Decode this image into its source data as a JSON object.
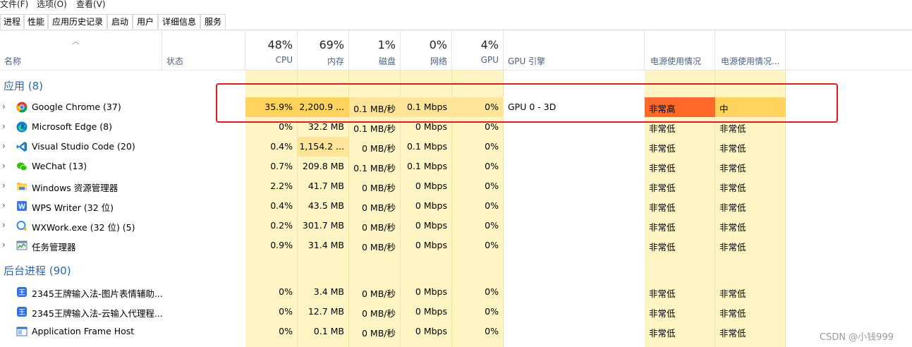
{
  "menu": [
    "文件(F)",
    "选项(O)",
    "查看(V)"
  ],
  "tabs": [
    "进程",
    "性能",
    "应用历史记录",
    "启动",
    "用户",
    "详细信息",
    "服务"
  ],
  "columns": {
    "name": "名称",
    "status": "状态",
    "cpu": {
      "pct": "48%",
      "label": "CPU"
    },
    "memory": {
      "pct": "69%",
      "label": "内存"
    },
    "disk": {
      "pct": "1%",
      "label": "磁盘"
    },
    "network": {
      "pct": "0%",
      "label": "网络"
    },
    "gpu": {
      "pct": "4%",
      "label": "GPU"
    },
    "gpu_engine": "GPU 引擎",
    "power": "电源使用情况",
    "power_trend": "电源使用情况..."
  },
  "sections": {
    "apps": "应用 (8)",
    "background": "后台进程 (90)"
  },
  "apps": [
    {
      "name": "Google Chrome (37)",
      "icon": "chrome-icon",
      "cpu": "35.9%",
      "mem": "2,200.9 ...",
      "disk": "0.1 MB/秒",
      "net": "0.1 Mbps",
      "gpu": "0%",
      "engine": "GPU 0 - 3D",
      "power": "非常高",
      "trend": "中"
    },
    {
      "name": "Microsoft Edge (8)",
      "icon": "edge-icon",
      "cpu": "0%",
      "mem": "32.2 MB",
      "disk": "0.1 MB/秒",
      "net": "0 Mbps",
      "gpu": "0%",
      "engine": "",
      "power": "非常低",
      "trend": "非常低"
    },
    {
      "name": "Visual Studio Code (20)",
      "icon": "vscode-icon",
      "cpu": "0.4%",
      "mem": "1,154.2 ...",
      "disk": "0 MB/秒",
      "net": "0.1 Mbps",
      "gpu": "0%",
      "engine": "",
      "power": "非常低",
      "trend": "非常低"
    },
    {
      "name": "WeChat (13)",
      "icon": "wechat-icon",
      "cpu": "0.7%",
      "mem": "209.8 MB",
      "disk": "0.1 MB/秒",
      "net": "0.1 Mbps",
      "gpu": "0%",
      "engine": "",
      "power": "非常低",
      "trend": "非常低"
    },
    {
      "name": "Windows 资源管理器",
      "icon": "explorer-icon",
      "cpu": "2.2%",
      "mem": "41.7 MB",
      "disk": "0 MB/秒",
      "net": "0 Mbps",
      "gpu": "0%",
      "engine": "",
      "power": "非常低",
      "trend": "非常低"
    },
    {
      "name": "WPS Writer (32 位)",
      "icon": "wps-writer-icon",
      "cpu": "0.4%",
      "mem": "43.5 MB",
      "disk": "0 MB/秒",
      "net": "0 Mbps",
      "gpu": "0%",
      "engine": "",
      "power": "非常低",
      "trend": "非常低"
    },
    {
      "name": "WXWork.exe (32 位) (5)",
      "icon": "wxwork-icon",
      "cpu": "0.2%",
      "mem": "301.7 MB",
      "disk": "0 MB/秒",
      "net": "0 Mbps",
      "gpu": "0%",
      "engine": "",
      "power": "非常低",
      "trend": "非常低"
    },
    {
      "name": "任务管理器",
      "icon": "task-manager-icon",
      "cpu": "0.9%",
      "mem": "31.4 MB",
      "disk": "0 MB/秒",
      "net": "0 Mbps",
      "gpu": "0%",
      "engine": "",
      "power": "非常低",
      "trend": "非常低"
    }
  ],
  "background": [
    {
      "name": "2345王牌输入法-图片表情辅助...",
      "icon": "ime-2345-icon",
      "cpu": "0%",
      "mem": "3.4 MB",
      "disk": "0 MB/秒",
      "net": "0 Mbps",
      "gpu": "0%",
      "engine": "",
      "power": "非常低",
      "trend": "非常低"
    },
    {
      "name": "2345王牌输入法-云输入代理程...",
      "icon": "ime-2345-icon",
      "cpu": "0%",
      "mem": "12.7 MB",
      "disk": "0 MB/秒",
      "net": "0 Mbps",
      "gpu": "0%",
      "engine": "",
      "power": "非常低",
      "trend": "非常低"
    },
    {
      "name": "Application Frame Host",
      "icon": "app-frame-host-icon",
      "cpu": "0%",
      "mem": "0.1 MB",
      "disk": "0 MB/秒",
      "net": "0 Mbps",
      "gpu": "0%",
      "engine": "",
      "power": "非常低",
      "trend": "非常低"
    }
  ],
  "colors": {
    "cell_light": "#fff4c4",
    "cell_medium": "#ffe49a",
    "cell_high": "#ffd35e",
    "power_very_high": "#ff6a2a",
    "highlight_border": "#e21b1b",
    "section_blue": "#2b67b5"
  },
  "watermark": "CSDN @小钱999"
}
